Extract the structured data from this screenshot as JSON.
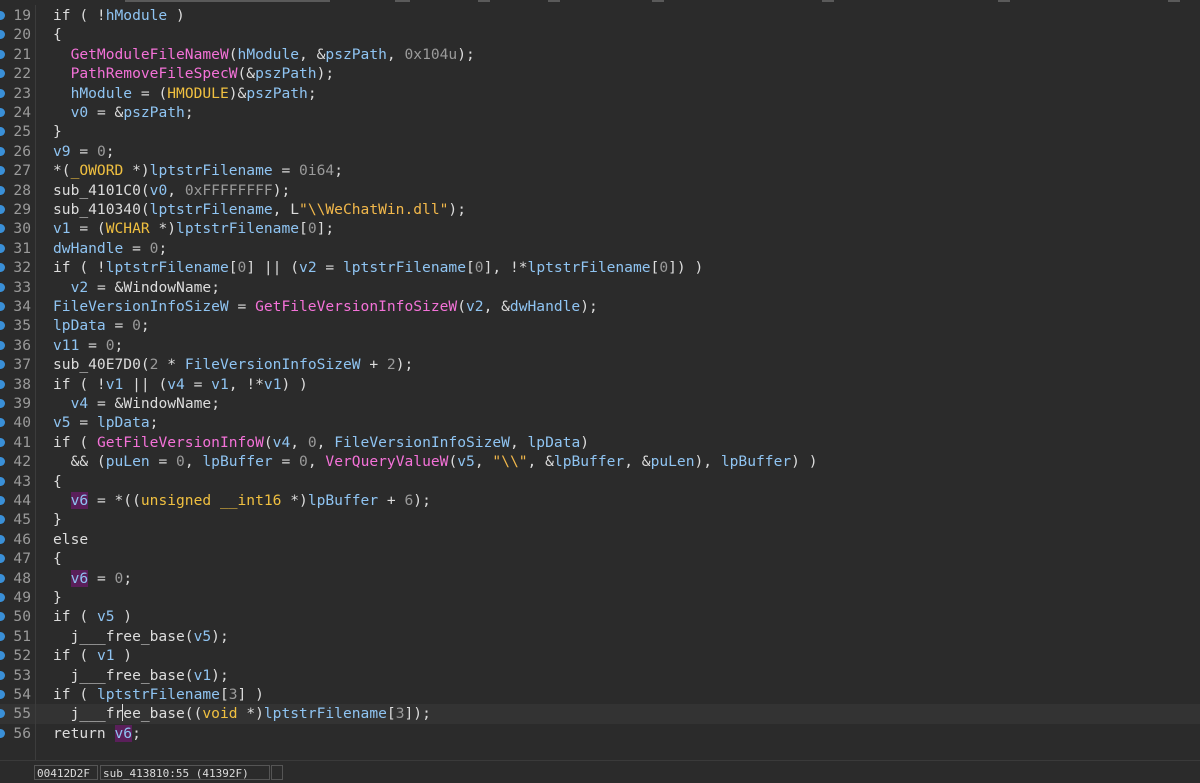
{
  "status_bar": {
    "address": "00412D2F",
    "location": "sub_413810:55 (41392F)",
    "extra": ""
  },
  "lines": [
    {
      "n": "19",
      "t": [
        [
          "kw",
          "if ( !"
        ],
        [
          "vr",
          "hModule"
        ],
        [
          "kw",
          " )"
        ]
      ]
    },
    {
      "n": "20",
      "t": [
        [
          "kw",
          "{"
        ]
      ]
    },
    {
      "n": "21",
      "t": [
        [
          "kw",
          "  "
        ],
        [
          "fn",
          "GetModuleFileNameW"
        ],
        [
          "kw",
          "("
        ],
        [
          "vr",
          "hModule"
        ],
        [
          "kw",
          ", &"
        ],
        [
          "vr",
          "pszPath"
        ],
        [
          "kw",
          ", "
        ],
        [
          "num",
          "0x104u"
        ],
        [
          "kw",
          ");"
        ]
      ]
    },
    {
      "n": "22",
      "t": [
        [
          "kw",
          "  "
        ],
        [
          "fn",
          "PathRemoveFileSpecW"
        ],
        [
          "kw",
          "(&"
        ],
        [
          "vr",
          "pszPath"
        ],
        [
          "kw",
          ");"
        ]
      ]
    },
    {
      "n": "23",
      "t": [
        [
          "kw",
          "  "
        ],
        [
          "vr",
          "hModule"
        ],
        [
          "kw",
          " = ("
        ],
        [
          "ty",
          "HMODULE"
        ],
        [
          "kw",
          ")&"
        ],
        [
          "vr",
          "pszPath"
        ],
        [
          "kw",
          ";"
        ]
      ]
    },
    {
      "n": "24",
      "t": [
        [
          "kw",
          "  "
        ],
        [
          "vr",
          "v0"
        ],
        [
          "kw",
          " = &"
        ],
        [
          "vr",
          "pszPath"
        ],
        [
          "kw",
          ";"
        ]
      ]
    },
    {
      "n": "25",
      "t": [
        [
          "kw",
          "}"
        ]
      ]
    },
    {
      "n": "26",
      "t": [
        [
          "vr",
          "v9"
        ],
        [
          "kw",
          " = "
        ],
        [
          "num",
          "0"
        ],
        [
          "kw",
          ";"
        ]
      ]
    },
    {
      "n": "27",
      "t": [
        [
          "kw",
          "*("
        ],
        [
          "ty",
          "_OWORD"
        ],
        [
          "kw",
          " *)"
        ],
        [
          "vr",
          "lptstrFilename"
        ],
        [
          "kw",
          " = "
        ],
        [
          "num",
          "0i64"
        ],
        [
          "kw",
          ";"
        ]
      ]
    },
    {
      "n": "28",
      "t": [
        [
          "kw",
          "sub_4101C0("
        ],
        [
          "vr",
          "v0"
        ],
        [
          "kw",
          ", "
        ],
        [
          "num",
          "0xFFFFFFFF"
        ],
        [
          "kw",
          ");"
        ]
      ]
    },
    {
      "n": "29",
      "t": [
        [
          "kw",
          "sub_410340("
        ],
        [
          "vr",
          "lptstrFilename"
        ],
        [
          "kw",
          ", L"
        ],
        [
          "str",
          "\"\\\\WeChatWin.dll\""
        ],
        [
          "kw",
          ");"
        ]
      ]
    },
    {
      "n": "30",
      "t": [
        [
          "vr",
          "v1"
        ],
        [
          "kw",
          " = ("
        ],
        [
          "ty",
          "WCHAR"
        ],
        [
          "kw",
          " *)"
        ],
        [
          "vr",
          "lptstrFilename"
        ],
        [
          "kw",
          "["
        ],
        [
          "num",
          "0"
        ],
        [
          "kw",
          "];"
        ]
      ]
    },
    {
      "n": "31",
      "t": [
        [
          "vr",
          "dwHandle"
        ],
        [
          "kw",
          " = "
        ],
        [
          "num",
          "0"
        ],
        [
          "kw",
          ";"
        ]
      ]
    },
    {
      "n": "32",
      "t": [
        [
          "kw",
          "if ( !"
        ],
        [
          "vr",
          "lptstrFilename"
        ],
        [
          "kw",
          "["
        ],
        [
          "num",
          "0"
        ],
        [
          "kw",
          "] || ("
        ],
        [
          "vr",
          "v2"
        ],
        [
          "kw",
          " = "
        ],
        [
          "vr",
          "lptstrFilename"
        ],
        [
          "kw",
          "["
        ],
        [
          "num",
          "0"
        ],
        [
          "kw",
          "], !*"
        ],
        [
          "vr",
          "lptstrFilename"
        ],
        [
          "kw",
          "["
        ],
        [
          "num",
          "0"
        ],
        [
          "kw",
          "]) )"
        ]
      ]
    },
    {
      "n": "33",
      "t": [
        [
          "kw",
          "  "
        ],
        [
          "vr",
          "v2"
        ],
        [
          "kw",
          " = &"
        ],
        [
          "kw",
          "WindowName"
        ],
        [
          "kw",
          ";"
        ]
      ]
    },
    {
      "n": "34",
      "t": [
        [
          "vr",
          "FileVersionInfoSizeW"
        ],
        [
          "kw",
          " = "
        ],
        [
          "fn",
          "GetFileVersionInfoSizeW"
        ],
        [
          "kw",
          "("
        ],
        [
          "vr",
          "v2"
        ],
        [
          "kw",
          ", &"
        ],
        [
          "vr",
          "dwHandle"
        ],
        [
          "kw",
          ");"
        ]
      ]
    },
    {
      "n": "35",
      "t": [
        [
          "vr",
          "lpData"
        ],
        [
          "kw",
          " = "
        ],
        [
          "num",
          "0"
        ],
        [
          "kw",
          ";"
        ]
      ]
    },
    {
      "n": "36",
      "t": [
        [
          "vr",
          "v11"
        ],
        [
          "kw",
          " = "
        ],
        [
          "num",
          "0"
        ],
        [
          "kw",
          ";"
        ]
      ]
    },
    {
      "n": "37",
      "t": [
        [
          "kw",
          "sub_40E7D0("
        ],
        [
          "num",
          "2"
        ],
        [
          "kw",
          " * "
        ],
        [
          "vr",
          "FileVersionInfoSizeW"
        ],
        [
          "kw",
          " + "
        ],
        [
          "num",
          "2"
        ],
        [
          "kw",
          ");"
        ]
      ]
    },
    {
      "n": "38",
      "t": [
        [
          "kw",
          "if ( !"
        ],
        [
          "vr",
          "v1"
        ],
        [
          "kw",
          " || ("
        ],
        [
          "vr",
          "v4"
        ],
        [
          "kw",
          " = "
        ],
        [
          "vr",
          "v1"
        ],
        [
          "kw",
          ", !*"
        ],
        [
          "vr",
          "v1"
        ],
        [
          "kw",
          ") )"
        ]
      ]
    },
    {
      "n": "39",
      "t": [
        [
          "kw",
          "  "
        ],
        [
          "vr",
          "v4"
        ],
        [
          "kw",
          " = &"
        ],
        [
          "kw",
          "WindowName"
        ],
        [
          "kw",
          ";"
        ]
      ]
    },
    {
      "n": "40",
      "t": [
        [
          "vr",
          "v5"
        ],
        [
          "kw",
          " = "
        ],
        [
          "vr",
          "lpData"
        ],
        [
          "kw",
          ";"
        ]
      ]
    },
    {
      "n": "41",
      "t": [
        [
          "kw",
          "if ( "
        ],
        [
          "fn",
          "GetFileVersionInfoW"
        ],
        [
          "kw",
          "("
        ],
        [
          "vr",
          "v4"
        ],
        [
          "kw",
          ", "
        ],
        [
          "num",
          "0"
        ],
        [
          "kw",
          ", "
        ],
        [
          "vr",
          "FileVersionInfoSizeW"
        ],
        [
          "kw",
          ", "
        ],
        [
          "vr",
          "lpData"
        ],
        [
          "kw",
          ")"
        ]
      ]
    },
    {
      "n": "42",
      "t": [
        [
          "kw",
          "  && ("
        ],
        [
          "vr",
          "puLen"
        ],
        [
          "kw",
          " = "
        ],
        [
          "num",
          "0"
        ],
        [
          "kw",
          ", "
        ],
        [
          "vr",
          "lpBuffer"
        ],
        [
          "kw",
          " = "
        ],
        [
          "num",
          "0"
        ],
        [
          "kw",
          ", "
        ],
        [
          "fn",
          "VerQueryValueW"
        ],
        [
          "kw",
          "("
        ],
        [
          "vr",
          "v5"
        ],
        [
          "kw",
          ", "
        ],
        [
          "str",
          "\"\\\\\""
        ],
        [
          "kw",
          ", &"
        ],
        [
          "vr",
          "lpBuffer"
        ],
        [
          "kw",
          ", &"
        ],
        [
          "vr",
          "puLen"
        ],
        [
          "kw",
          "), "
        ],
        [
          "vr",
          "lpBuffer"
        ],
        [
          "kw",
          ") )"
        ]
      ]
    },
    {
      "n": "43",
      "t": [
        [
          "kw",
          "{"
        ]
      ]
    },
    {
      "n": "44",
      "t": [
        [
          "kw",
          "  "
        ],
        [
          "hl",
          "v6"
        ],
        [
          "kw",
          " = *(("
        ],
        [
          "ty",
          "unsigned __int16"
        ],
        [
          "kw",
          " *)"
        ],
        [
          "vr",
          "lpBuffer"
        ],
        [
          "kw",
          " + "
        ],
        [
          "num",
          "6"
        ],
        [
          "kw",
          ");"
        ]
      ]
    },
    {
      "n": "45",
      "t": [
        [
          "kw",
          "}"
        ]
      ]
    },
    {
      "n": "46",
      "t": [
        [
          "kw",
          "else"
        ]
      ]
    },
    {
      "n": "47",
      "t": [
        [
          "kw",
          "{"
        ]
      ]
    },
    {
      "n": "48",
      "t": [
        [
          "kw",
          "  "
        ],
        [
          "hl",
          "v6"
        ],
        [
          "kw",
          " = "
        ],
        [
          "num",
          "0"
        ],
        [
          "kw",
          ";"
        ]
      ]
    },
    {
      "n": "49",
      "t": [
        [
          "kw",
          "}"
        ]
      ]
    },
    {
      "n": "50",
      "t": [
        [
          "kw",
          "if ( "
        ],
        [
          "vr",
          "v5"
        ],
        [
          "kw",
          " )"
        ]
      ]
    },
    {
      "n": "51",
      "t": [
        [
          "kw",
          "  j___free_base("
        ],
        [
          "vr",
          "v5"
        ],
        [
          "kw",
          ");"
        ]
      ]
    },
    {
      "n": "52",
      "t": [
        [
          "kw",
          "if ( "
        ],
        [
          "vr",
          "v1"
        ],
        [
          "kw",
          " )"
        ]
      ]
    },
    {
      "n": "53",
      "t": [
        [
          "kw",
          "  j___free_base("
        ],
        [
          "vr",
          "v1"
        ],
        [
          "kw",
          ");"
        ]
      ]
    },
    {
      "n": "54",
      "t": [
        [
          "kw",
          "if ( "
        ],
        [
          "vr",
          "lptstrFilename"
        ],
        [
          "kw",
          "["
        ],
        [
          "num",
          "3"
        ],
        [
          "kw",
          "] )"
        ]
      ]
    },
    {
      "n": "55",
      "t": [
        [
          "kw",
          "  j___fr"
        ],
        [
          "caret",
          ""
        ],
        [
          "kw",
          "ee_base(("
        ],
        [
          "ty",
          "void"
        ],
        [
          "kw",
          " *)"
        ],
        [
          "vr",
          "lptstrFilename"
        ],
        [
          "kw",
          "["
        ],
        [
          "num",
          "3"
        ],
        [
          "kw",
          "]);"
        ]
      ]
    },
    {
      "n": "56",
      "t": [
        [
          "kw",
          "return "
        ],
        [
          "hl",
          "v6"
        ],
        [
          "kw",
          ";"
        ]
      ]
    }
  ]
}
